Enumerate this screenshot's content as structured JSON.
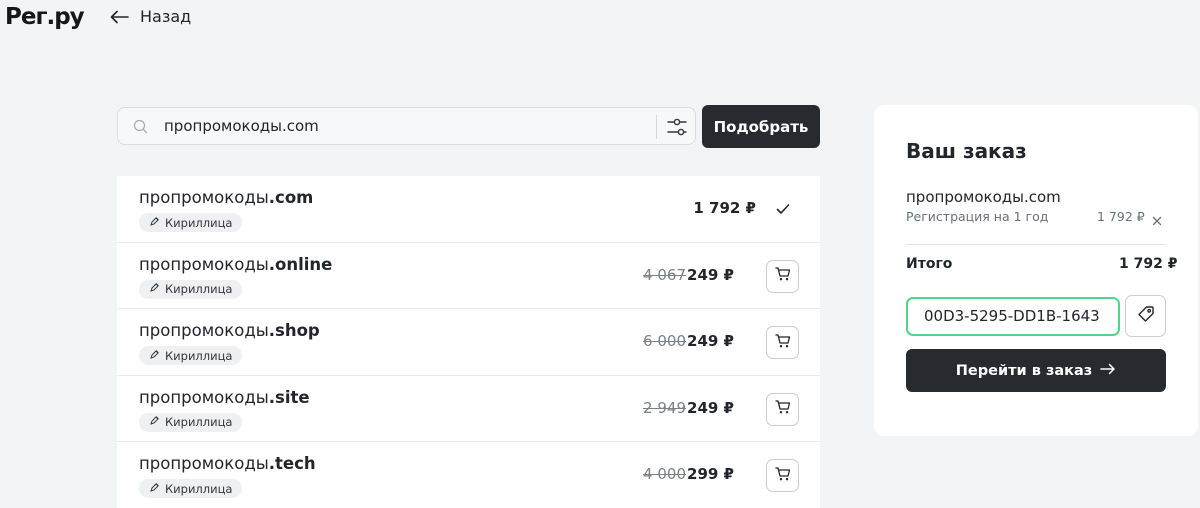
{
  "header": {
    "logo": "Рег.ру",
    "back_label": "Назад"
  },
  "search": {
    "value": "пропромокоды.com",
    "submit_label": "Подобрать"
  },
  "domains": [
    {
      "name": "пропромокоды",
      "tld": ".com",
      "tag": "Кириллица",
      "old_price": "",
      "price": "1 792 ₽",
      "selected": true
    },
    {
      "name": "пропромокоды",
      "tld": ".online",
      "tag": "Кириллица",
      "old_price": "4 067",
      "price": "249 ₽",
      "selected": false
    },
    {
      "name": "пропромокоды",
      "tld": ".shop",
      "tag": "Кириллица",
      "old_price": "6 000",
      "price": "249 ₽",
      "selected": false
    },
    {
      "name": "пропромокоды",
      "tld": ".site",
      "tag": "Кириллица",
      "old_price": "2 949",
      "price": "249 ₽",
      "selected": false
    },
    {
      "name": "пропромокоды",
      "tld": ".tech",
      "tag": "Кириллица",
      "old_price": "4 000",
      "price": "299 ₽",
      "selected": false
    }
  ],
  "order": {
    "title": "Ваш заказ",
    "item_domain": "пропромокоды.com",
    "item_desc": "Регистрация на 1 год",
    "item_price": "1 792 ₽",
    "total_label": "Итого",
    "total_value": "1 792 ₽",
    "promo_value": "00D3-5295-DD1B-1643",
    "checkout_label": "Перейти в заказ"
  },
  "colors": {
    "dark_button": "#272a2f",
    "promo_border": "#4fd58a",
    "page_bg": "#f3f4f6"
  }
}
